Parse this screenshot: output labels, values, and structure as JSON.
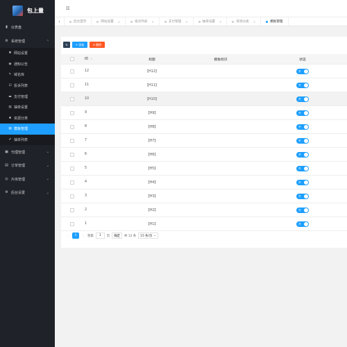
{
  "app": {
    "logo_text": "包上量"
  },
  "topbar": {
    "toggle_icon": "☷"
  },
  "sidebar": {
    "items": [
      {
        "label": "仪表盘",
        "icon": "▮",
        "chevron": ""
      },
      {
        "label": "系统管理",
        "icon": "⚙",
        "chevron": "⌃"
      }
    ],
    "submenu": [
      {
        "label": "网站设置",
        "icon": "✱",
        "active": false
      },
      {
        "label": "通知公告",
        "icon": "◉",
        "active": false
      },
      {
        "label": "域名库",
        "icon": "✎",
        "active": false
      },
      {
        "label": "投诉列表",
        "icon": "☑",
        "active": false
      },
      {
        "label": "支付管理",
        "icon": "▬",
        "active": false
      },
      {
        "label": "抽单设置",
        "icon": "▥",
        "active": false
      },
      {
        "label": "资源分类",
        "icon": "♣",
        "active": false
      },
      {
        "label": "模板管理",
        "icon": "▤",
        "active": true
      },
      {
        "label": "抽单列表",
        "icon": "✐",
        "active": false
      }
    ],
    "items_after": [
      {
        "label": "代理管理",
        "icon": "▣",
        "chevron": "⌄"
      },
      {
        "label": "订单管理",
        "icon": "▤",
        "chevron": "⌄"
      },
      {
        "label": "片库管理",
        "icon": "◎",
        "chevron": "⌄"
      },
      {
        "label": "后台设置",
        "icon": "⚙",
        "chevron": "⌄"
      }
    ]
  },
  "tabs": {
    "prev_icon": "‹",
    "items": [
      {
        "label": "后台首页",
        "active": false,
        "closable": false
      },
      {
        "label": "网站设置",
        "active": false,
        "closable": true
      },
      {
        "label": "投诉列表",
        "active": false,
        "closable": true
      },
      {
        "label": "支付管理",
        "active": false,
        "closable": true
      },
      {
        "label": "抽单设置",
        "active": false,
        "closable": true
      },
      {
        "label": "资源分类",
        "active": false,
        "closable": true
      },
      {
        "label": "模板管理",
        "active": true,
        "closable": false
      }
    ]
  },
  "toolbar": {
    "refresh_icon": "↻",
    "add_label": "+ 添加",
    "delete_label": "⊖ 删除"
  },
  "table": {
    "headers": {
      "id": "ID",
      "sort_icon": "⇕",
      "title": "标题",
      "mark": "模板标识",
      "status": "状态"
    },
    "switch_label": "开",
    "rows": [
      {
        "id": "12",
        "title": "【H12】",
        "mark": "",
        "on": true,
        "highlight": false
      },
      {
        "id": "11",
        "title": "【H11】",
        "mark": "",
        "on": true,
        "highlight": false
      },
      {
        "id": "10",
        "title": "【H10】",
        "mark": "",
        "on": true,
        "highlight": true
      },
      {
        "id": "9",
        "title": "【H9】",
        "mark": "",
        "on": true,
        "highlight": false
      },
      {
        "id": "8",
        "title": "【H8】",
        "mark": "",
        "on": true,
        "highlight": false
      },
      {
        "id": "7",
        "title": "【H7】",
        "mark": "",
        "on": true,
        "highlight": false
      },
      {
        "id": "6",
        "title": "【H6】",
        "mark": "",
        "on": true,
        "highlight": false
      },
      {
        "id": "5",
        "title": "【H5】",
        "mark": "",
        "on": true,
        "highlight": false
      },
      {
        "id": "4",
        "title": "【H4】",
        "mark": "",
        "on": true,
        "highlight": false
      },
      {
        "id": "3",
        "title": "【H3】",
        "mark": "",
        "on": true,
        "highlight": false
      },
      {
        "id": "2",
        "title": "【H2】",
        "mark": "",
        "on": true,
        "highlight": false
      },
      {
        "id": "1",
        "title": "【H1】",
        "mark": "",
        "on": true,
        "highlight": false
      }
    ]
  },
  "pager": {
    "prev": "‹",
    "current": "1",
    "next": "›",
    "goto_label": "到第",
    "goto_value": "1",
    "page_unit": "页",
    "confirm_label": "确定",
    "total_text": "共 12 条",
    "page_size": "15 条/页",
    "select_chevron": "⌄"
  },
  "colors": {
    "accent": "#1e9fff",
    "sidebar_bg": "#20222a",
    "danger": "#ff5722",
    "dark_button": "#2f4056"
  }
}
